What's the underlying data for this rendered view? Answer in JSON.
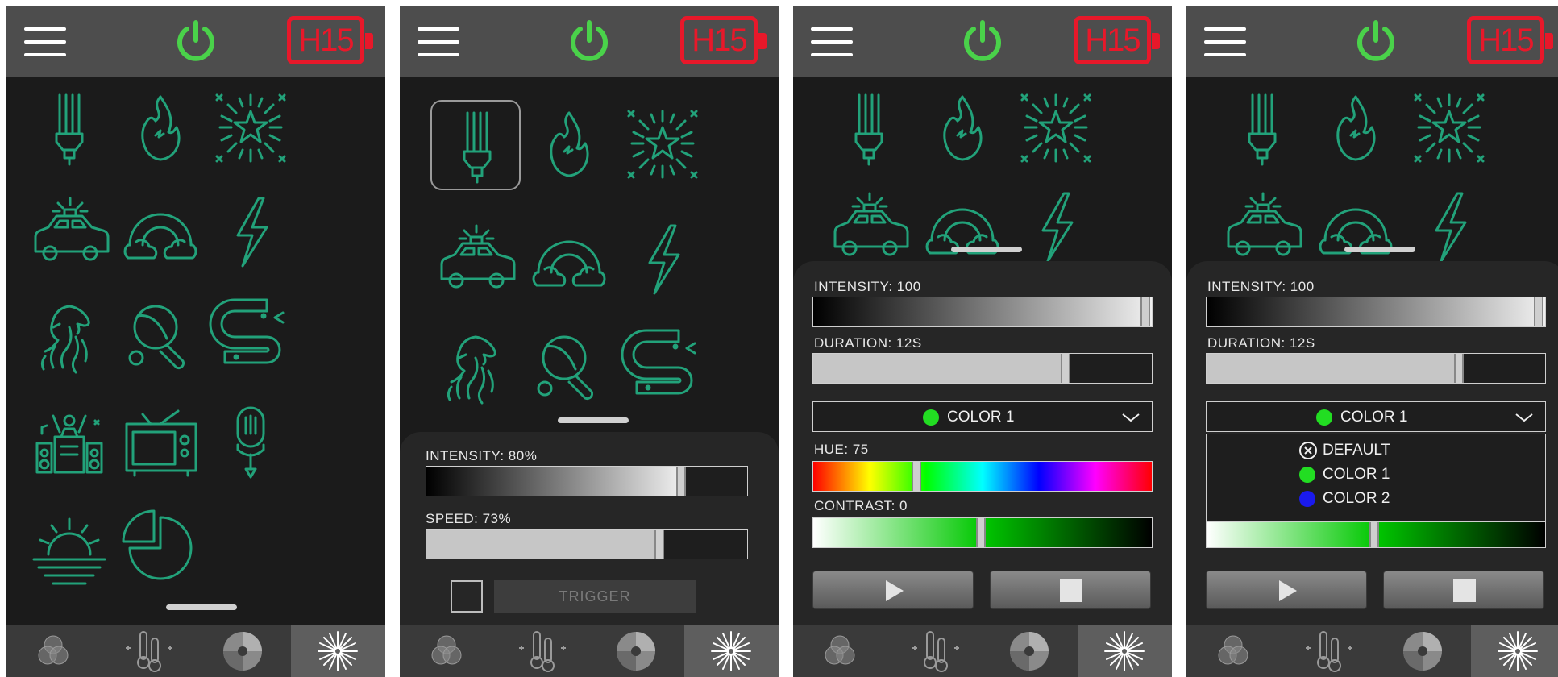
{
  "header": {
    "badge_label": "H15"
  },
  "screen2": {
    "intensity": {
      "label": "INTENSITY: 80%",
      "value": 0.8
    },
    "speed": {
      "label": "SPEED: 73%",
      "value": 0.73
    },
    "trigger_label": "TRIGGER"
  },
  "screen3": {
    "intensity": {
      "label": "INTENSITY: 100",
      "value": 1.0
    },
    "duration": {
      "label": "DURATION: 12S",
      "value": 0.75
    },
    "color_select": {
      "selected": "COLOR 1",
      "color": "#22dd22"
    },
    "hue": {
      "label": "HUE: 75",
      "value": 0.31
    },
    "contrast": {
      "label": "CONTRAST: 0",
      "value": 0.5
    }
  },
  "screen4": {
    "intensity": {
      "label": "INTENSITY: 100",
      "value": 1.0
    },
    "duration": {
      "label": "DURATION: 12S",
      "value": 0.75
    },
    "color_select": {
      "selected": "COLOR 1",
      "color": "#22dd22"
    },
    "options": [
      {
        "label": "DEFAULT",
        "icon": "close-circle-icon"
      },
      {
        "label": "COLOR 1",
        "color": "#22dd22"
      },
      {
        "label": "COLOR 2",
        "color": "#1a1aee"
      }
    ],
    "contrast": {
      "value": 0.5
    }
  },
  "effects": [
    "bulb",
    "fire",
    "fireworks",
    "police-car",
    "rainbow",
    "lightning",
    "lion",
    "ping-pong",
    "snake",
    "party",
    "tv",
    "microphone",
    "sunset",
    "pie-chart"
  ],
  "tabs": [
    "color-mix",
    "temperature",
    "color-wheel",
    "effects"
  ],
  "colors": {
    "accent_green": "#22a27a",
    "power_green": "#4ad24a",
    "badge_red": "#e8182a"
  }
}
